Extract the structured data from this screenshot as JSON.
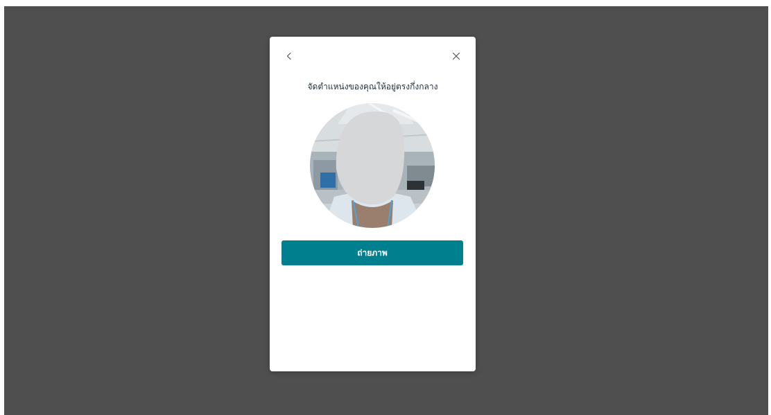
{
  "colors": {
    "backdrop": "#4f4f4f",
    "modal_bg": "#ffffff",
    "primary": "#00808f",
    "title_text": "#1f2f3a",
    "icon": "#555555"
  },
  "modal": {
    "back_icon": "chevron-left-icon",
    "close_icon": "close-icon",
    "title": "จัดตำแหน่งของคุณให้อยู่ตรงกึ่งกลาง",
    "capture_button_label": "ถ่ายภาพ"
  }
}
